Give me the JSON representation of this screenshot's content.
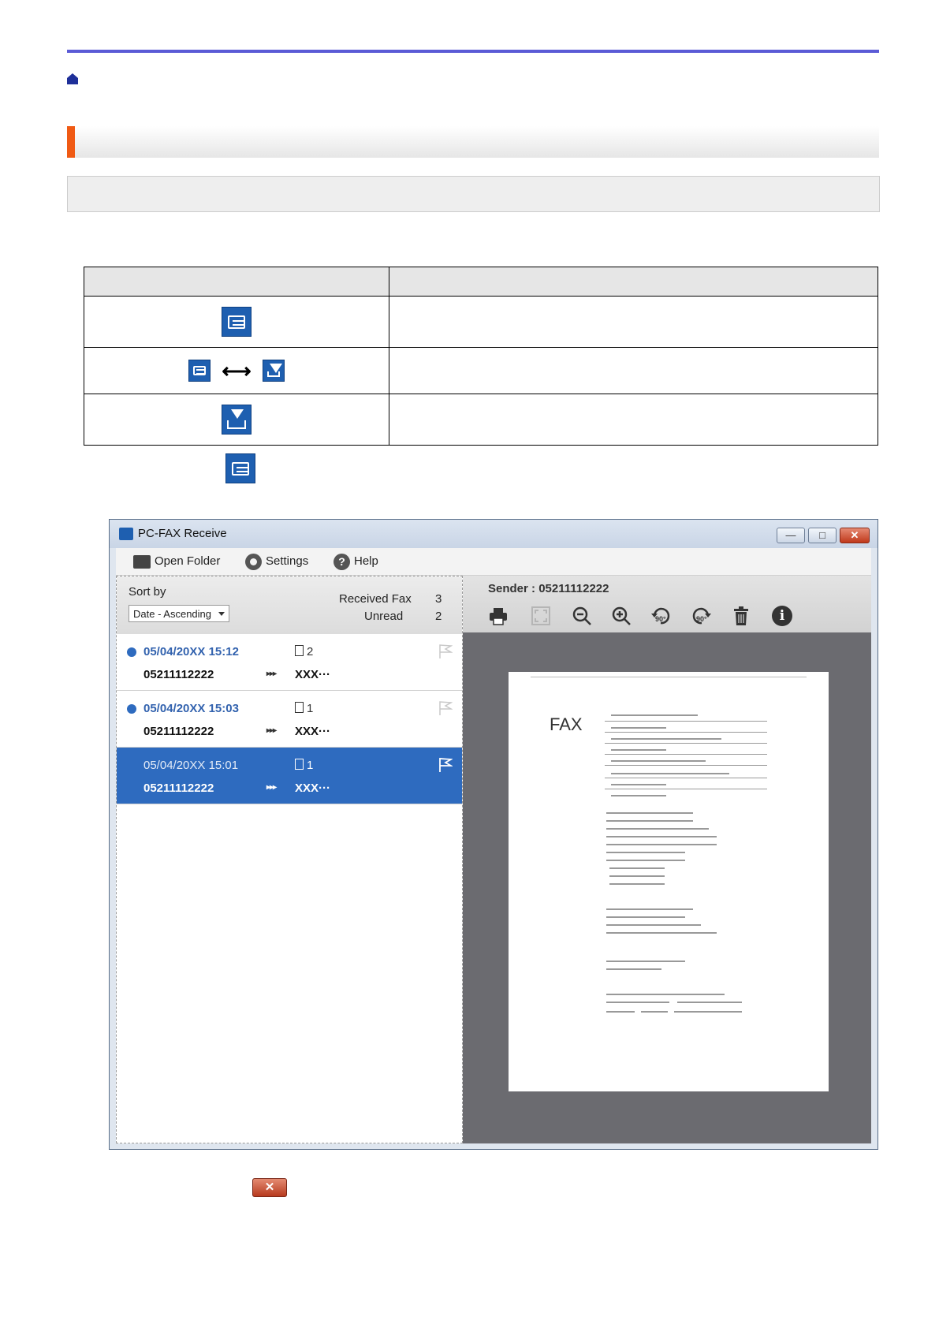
{
  "window": {
    "title": "PC-FAX Receive",
    "controls": {
      "minimize": "—",
      "maximize": "□",
      "close": "✕"
    },
    "menu": {
      "open_folder": "Open Folder",
      "settings": "Settings",
      "help": "Help"
    }
  },
  "list_pane": {
    "sort_label": "Sort by",
    "sort_value": "Date - Ascending",
    "received_fax_label": "Received Fax",
    "received_fax_count": "3",
    "unread_label": "Unread",
    "unread_count": "2",
    "faxes": [
      {
        "date": "05/04/20XX  15:12",
        "pages": "2",
        "number": "05211112222",
        "arrow": "▸▸▸",
        "name": "XXX···",
        "unread": true,
        "selected": false
      },
      {
        "date": "05/04/20XX  15:03",
        "pages": "1",
        "number": "05211112222",
        "arrow": "▸▸▸",
        "name": "XXX···",
        "unread": true,
        "selected": false
      },
      {
        "date": "05/04/20XX  15:01",
        "pages": "1",
        "number": "05211112222",
        "arrow": "▸▸▸",
        "name": "XXX···",
        "unread": false,
        "selected": true
      }
    ]
  },
  "preview_pane": {
    "sender_label": "Sender :",
    "sender_value": "05211112222",
    "toolbar_icons": [
      "print-icon",
      "fit-icon",
      "zoom-out-icon",
      "zoom-in-icon",
      "rotate-left-icon",
      "rotate-right-icon",
      "delete-icon",
      "info-icon"
    ],
    "rotate_left_label": "90°",
    "rotate_right_label": "90°",
    "page_heading": "FAX"
  },
  "close_button_glyph": "✕",
  "colors": {
    "top_rule": "#5b5bd6",
    "section_accent": "#f05a14",
    "icon_blue": "#1e5fb0",
    "selected_row": "#2e6bbf",
    "close_red": "#c0391b"
  }
}
